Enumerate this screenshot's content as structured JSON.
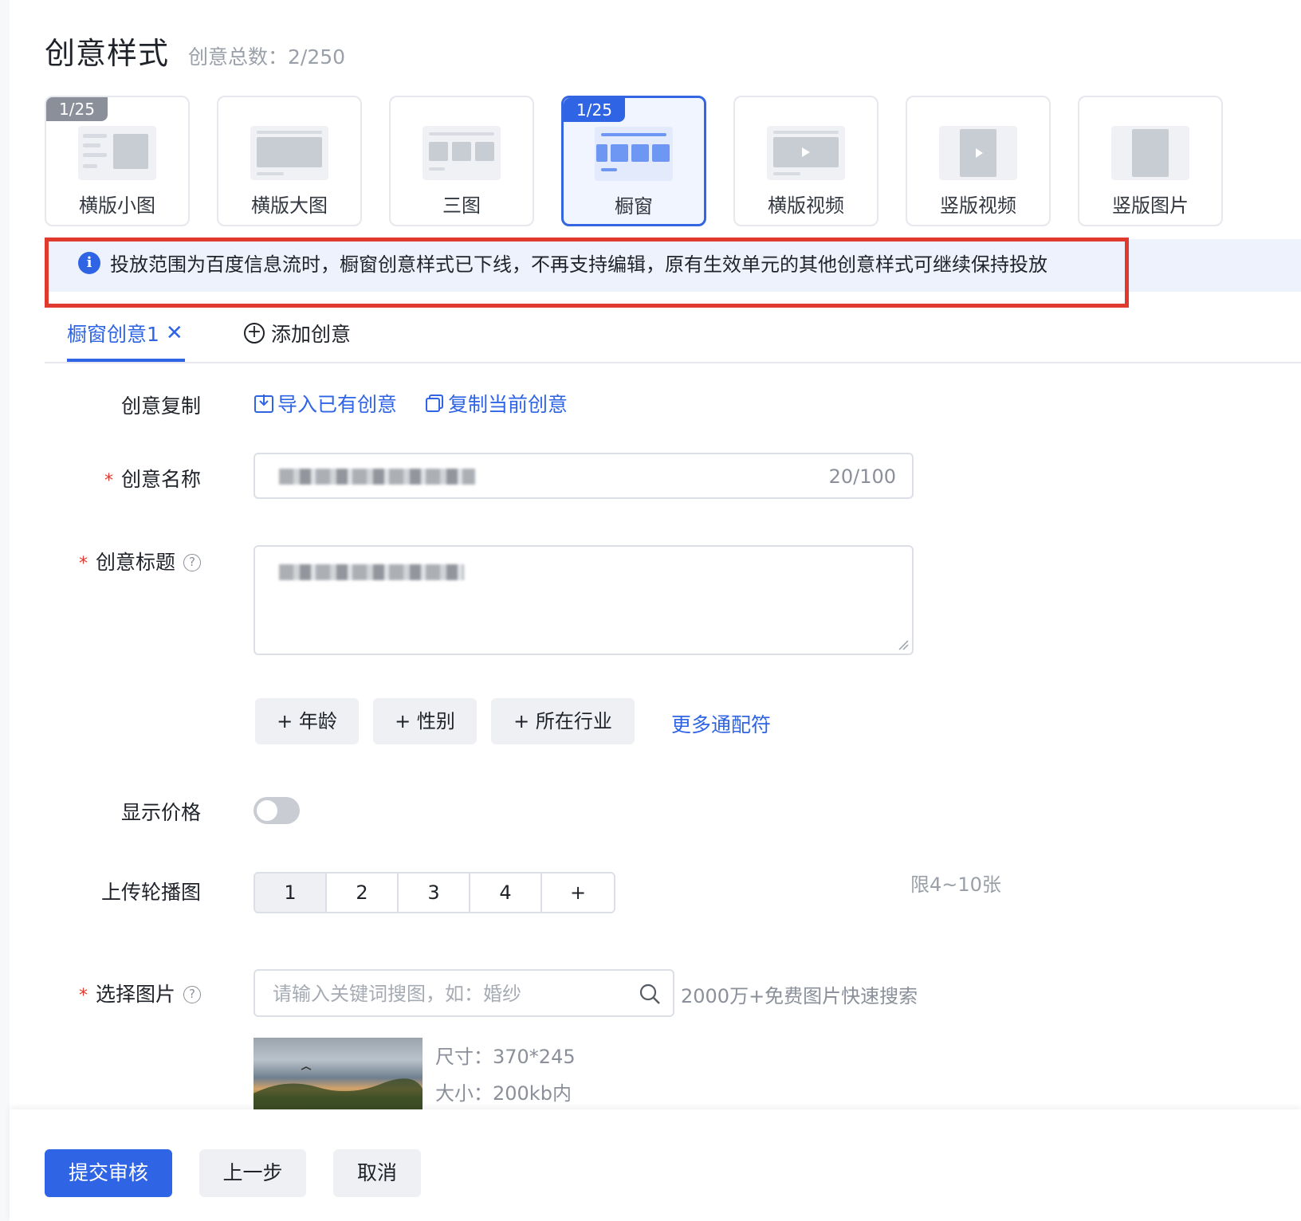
{
  "header": {
    "title": "创意样式",
    "count_label": "创意总数：2/250"
  },
  "style_cards": [
    {
      "label": "横版小图",
      "badge": "1/25",
      "active": false
    },
    {
      "label": "横版大图",
      "badge": "",
      "active": false
    },
    {
      "label": "三图",
      "badge": "",
      "active": false
    },
    {
      "label": "橱窗",
      "badge": "1/25",
      "active": true
    },
    {
      "label": "横版视频",
      "badge": "",
      "active": false
    },
    {
      "label": "竖版视频",
      "badge": "",
      "active": false
    },
    {
      "label": "竖版图片",
      "badge": "",
      "active": false
    }
  ],
  "notice": {
    "text": "投放范围为百度信息流时，橱窗创意样式已下线，不再支持编辑，原有生效单元的其他创意样式可继续保持投放"
  },
  "tabs": {
    "active_label": "橱窗创意1",
    "close_glyph": "✕",
    "add_label": "添加创意"
  },
  "form": {
    "copy": {
      "label": "创意复制",
      "import_link": "导入已有创意",
      "copy_link": "复制当前创意"
    },
    "name": {
      "required": "*",
      "label": "创意名称",
      "counter": "20/100"
    },
    "title": {
      "required": "*",
      "label": "创意标题",
      "help": "?"
    },
    "wildcards": {
      "chips": [
        "+ 年龄",
        "+ 性别",
        "+ 所在行业"
      ],
      "more_link": "更多通配符"
    },
    "price": {
      "label": "显示价格",
      "enabled": false
    },
    "carousel": {
      "label": "上传轮播图",
      "segments": [
        "1",
        "2",
        "3",
        "4",
        "+"
      ],
      "selected": "1",
      "limit": "限4~10张"
    },
    "image": {
      "required": "*",
      "label": "选择图片",
      "help": "?",
      "search_placeholder": "请输入关键词搜图，如：婚纱",
      "search_hint": "2000万+免费图片快速搜索",
      "size_text": "尺寸：370*245",
      "filesize_text": "大小：200kb内"
    }
  },
  "footer": {
    "submit": "提交审核",
    "prev": "上一步",
    "cancel": "取消"
  },
  "colors": {
    "primary": "#2f64e5",
    "alert_border": "#e03a2f",
    "notice_bg": "#eef2fd"
  }
}
